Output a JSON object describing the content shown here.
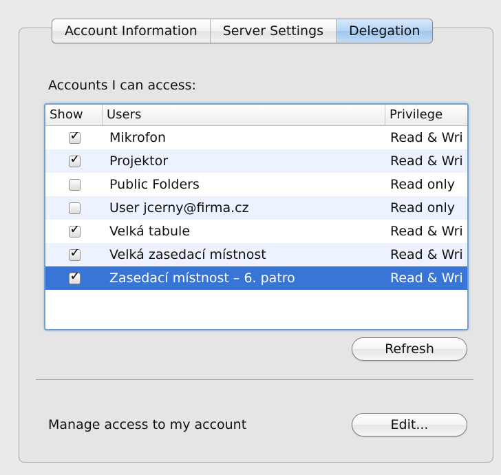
{
  "tabs": [
    {
      "label": "Account Information",
      "active": false
    },
    {
      "label": "Server Settings",
      "active": false
    },
    {
      "label": "Delegation",
      "active": true
    }
  ],
  "accounts": {
    "section_label": "Accounts I can access:",
    "columns": {
      "show": "Show",
      "users": "Users",
      "privilege": "Privilege"
    },
    "rows": [
      {
        "show": true,
        "user": "Mikrofon",
        "privilege": "Read & Wri",
        "selected": false
      },
      {
        "show": true,
        "user": "Projektor",
        "privilege": "Read & Wri",
        "selected": false
      },
      {
        "show": false,
        "user": "Public Folders",
        "privilege": "Read only",
        "selected": false
      },
      {
        "show": false,
        "user": "User jcerny@firma.cz",
        "privilege": "Read only",
        "selected": false
      },
      {
        "show": true,
        "user": "Velká tabule",
        "privilege": "Read & Wri",
        "selected": false
      },
      {
        "show": true,
        "user": "Velká zasedací místnost",
        "privilege": "Read & Wri",
        "selected": false
      },
      {
        "show": true,
        "user": "Zasedací místnost – 6. patro",
        "privilege": "Read & Wri",
        "selected": true
      }
    ],
    "refresh_label": "Refresh"
  },
  "manage": {
    "label": "Manage access to my account",
    "edit_label": "Edit..."
  },
  "colors": {
    "selection": "#3875d7",
    "alt_row": "#edf3fe",
    "active_tab": "#b4d3f4"
  }
}
